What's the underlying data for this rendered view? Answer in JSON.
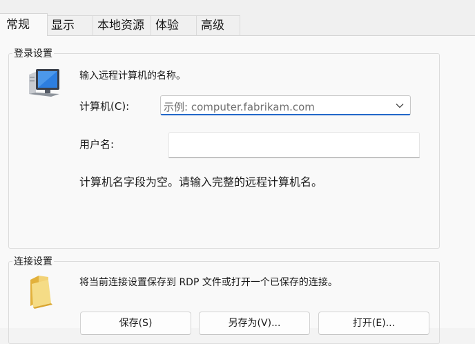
{
  "tabs": [
    {
      "label": "常规"
    },
    {
      "label": "显示"
    },
    {
      "label": "本地资源"
    },
    {
      "label": "体验"
    },
    {
      "label": "高级"
    }
  ],
  "logon": {
    "title": "登录设置",
    "instruction": "输入远程计算机的名称。",
    "computer_label": "计算机(C):",
    "computer_placeholder": "示例: computer.fabrikam.com",
    "computer_value": "",
    "username_label": "用户名:",
    "username_value": "",
    "error_message": "计算机名字段为空。请输入完整的远程计算机名。",
    "icon": "computer-monitor-icon"
  },
  "connection": {
    "title": "连接设置",
    "description": "将当前连接设置保存到 RDP 文件或打开一个已保存的连接。",
    "icon": "folder-icon",
    "save_label": "保存(S)",
    "save_as_label": "另存为(V)...",
    "open_label": "打开(E)..."
  },
  "colors": {
    "accent": "#2167c9",
    "background": "#f9f9f9"
  }
}
